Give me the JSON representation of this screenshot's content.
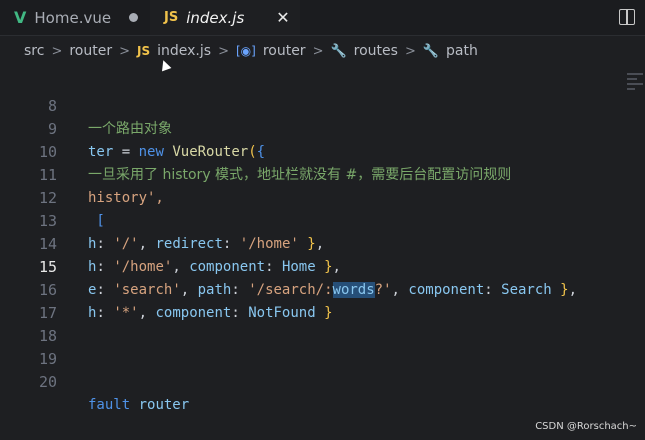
{
  "tabs": [
    {
      "icon": "V",
      "label": "Home.vue",
      "state": "modified"
    },
    {
      "icon": "JS",
      "label": "index.js",
      "state": "active"
    }
  ],
  "breadcrumb": {
    "items": [
      "src",
      "router",
      "index.js",
      "router",
      "routes",
      "path"
    ],
    "sep": ">",
    "js_icon": "JS"
  },
  "editor": {
    "lines": [
      {
        "num": "8",
        "text": "一个路由对象"
      },
      {
        "num": "9",
        "text": "ter = new VueRouter({"
      },
      {
        "num": "10",
        "text": "一旦采用了 history 模式，地址栏就没有 #，需要后台配置访问规则"
      },
      {
        "num": "11",
        "text": "history',"
      },
      {
        "num": "12",
        "text": " ["
      },
      {
        "num": "13",
        "text": "h: '/', redirect: '/home' },"
      },
      {
        "num": "14",
        "text": "h: '/home', component: Home },"
      },
      {
        "num": "15",
        "text": "e: 'search', path: '/search/:words?', component: Search },"
      },
      {
        "num": "16",
        "text": "h: '*', component: NotFound }"
      },
      {
        "num": "17",
        "text": ""
      },
      {
        "num": "18",
        "text": ""
      },
      {
        "num": "19",
        "text": ""
      },
      {
        "num": "20",
        "text": "fault router"
      }
    ],
    "current_line": "15",
    "selection": "words"
  },
  "watermark": "CSDN @Rorschach~"
}
